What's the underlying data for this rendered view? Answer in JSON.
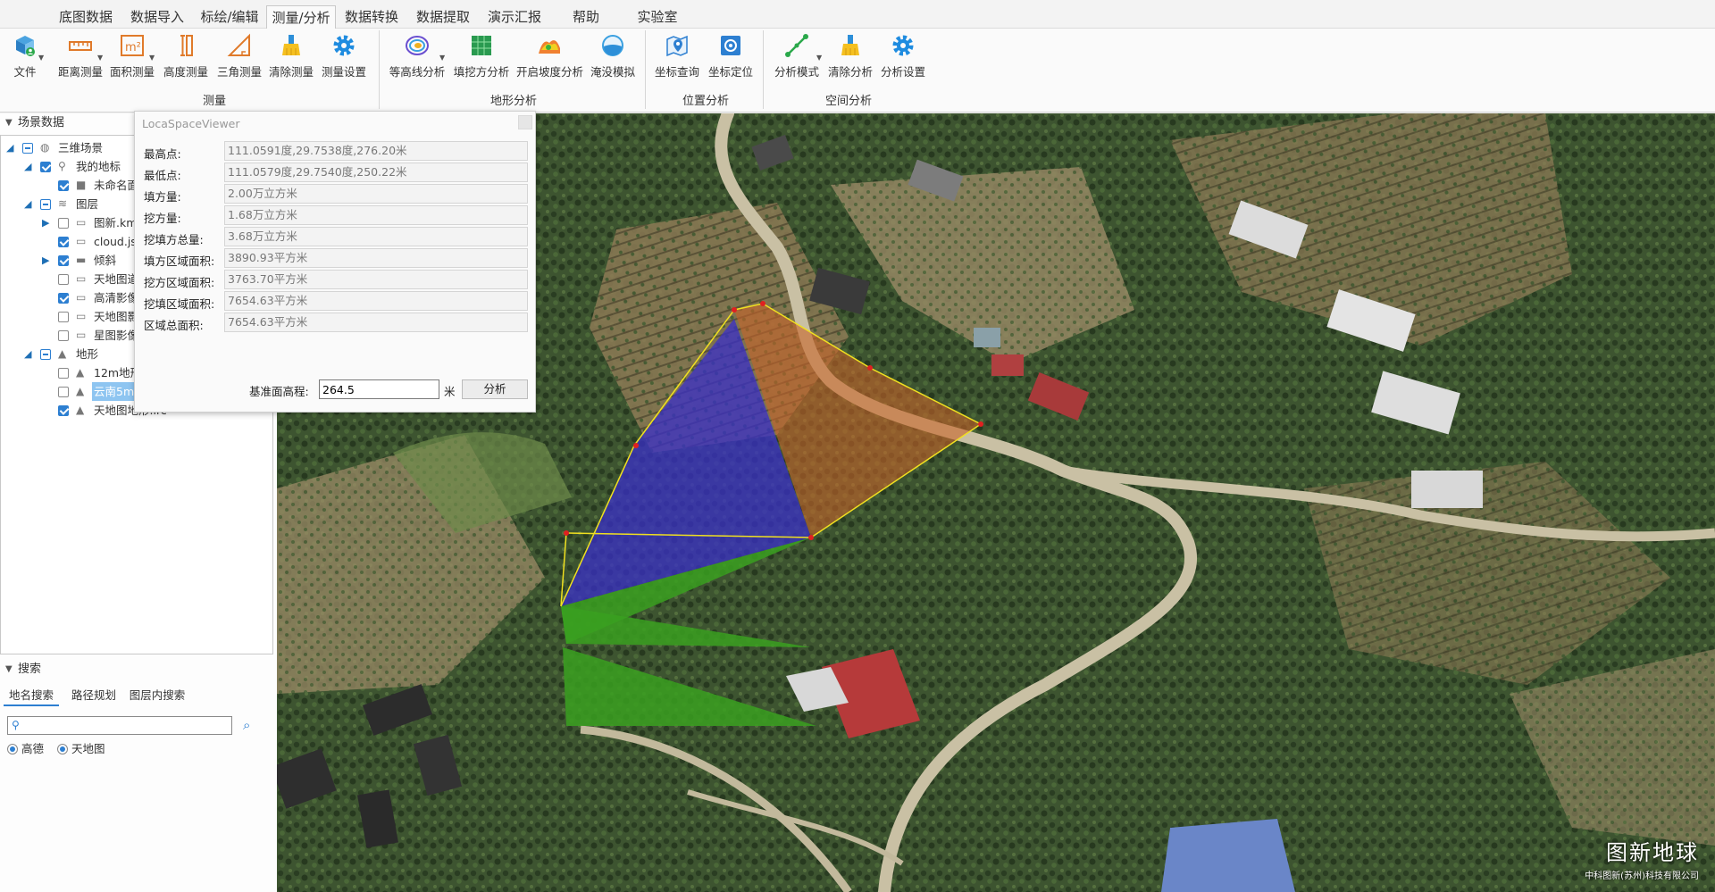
{
  "menu": {
    "tabs": [
      "底图数据",
      "数据导入",
      "标绘/编辑",
      "测量/分析",
      "数据转换",
      "数据提取",
      "演示汇报",
      "帮助",
      "实验室"
    ],
    "active_index": 3
  },
  "ribbon": {
    "file_label": "文件",
    "measure": {
      "group_label": "测量",
      "tools": [
        "距离测量",
        "面积测量",
        "高度测量",
        "三角测量",
        "清除测量",
        "测量设置"
      ]
    },
    "terrain": {
      "group_label": "地形分析",
      "tools": [
        "等高线分析",
        "填挖方分析",
        "开启坡度分析",
        "淹没模拟"
      ]
    },
    "position": {
      "group_label": "位置分析",
      "tools": [
        "坐标查询",
        "坐标定位"
      ]
    },
    "spatial": {
      "group_label": "空间分析",
      "tools": [
        "分析模式",
        "清除分析",
        "分析设置"
      ]
    },
    "area_icon_text": "m²"
  },
  "left_panel": {
    "scene_header": "场景数据",
    "tree": [
      {
        "label": "三维场景"
      },
      {
        "label": "我的地标"
      },
      {
        "label": "未命名面"
      },
      {
        "label": "图层"
      },
      {
        "label": "图新.km"
      },
      {
        "label": "cloud.js"
      },
      {
        "label": "倾斜"
      },
      {
        "label": "天地图道"
      },
      {
        "label": "高清影像"
      },
      {
        "label": "天地图影"
      },
      {
        "label": "星图影像"
      },
      {
        "label": "地形"
      },
      {
        "label": "12m地形"
      },
      {
        "label": "云南5m"
      },
      {
        "label": "天地图地形.lrc"
      }
    ],
    "search_header": "搜索",
    "search_tabs": [
      "地名搜索",
      "路径规划",
      "图层内搜索"
    ],
    "search_placeholder": "",
    "radios": [
      "高德",
      "天地图"
    ]
  },
  "dialog": {
    "title": "LocaSpaceViewer",
    "rows": [
      {
        "label": "最高点:",
        "value": "111.0591度,29.7538度,276.20米"
      },
      {
        "label": "最低点:",
        "value": "111.0579度,29.7540度,250.22米"
      },
      {
        "label": "填方量:",
        "value": "2.00万立方米"
      },
      {
        "label": "挖方量:",
        "value": "1.68万立方米"
      },
      {
        "label": "挖填方总量:",
        "value": "3.68万立方米"
      },
      {
        "label": "填方区域面积:",
        "value": "3890.93平方米"
      },
      {
        "label": "挖方区域面积:",
        "value": "3763.70平方米"
      },
      {
        "label": "挖填区域面积:",
        "value": "7654.63平方米"
      },
      {
        "label": "区域总面积:",
        "value": "7654.63平方米"
      }
    ],
    "base_label": "基准面高程:",
    "base_value": "264.5",
    "base_unit": "米",
    "analyze_label": "分析"
  },
  "watermark": {
    "title": "图新地球",
    "subtitle": "中科图新(苏州)科技有限公司"
  },
  "colors": {
    "fill_region": "#3a2fc8",
    "cut_region": "#c8642a",
    "side_wall": "#3aa020",
    "outline": "#f0e020",
    "vertex": "#e02020"
  }
}
